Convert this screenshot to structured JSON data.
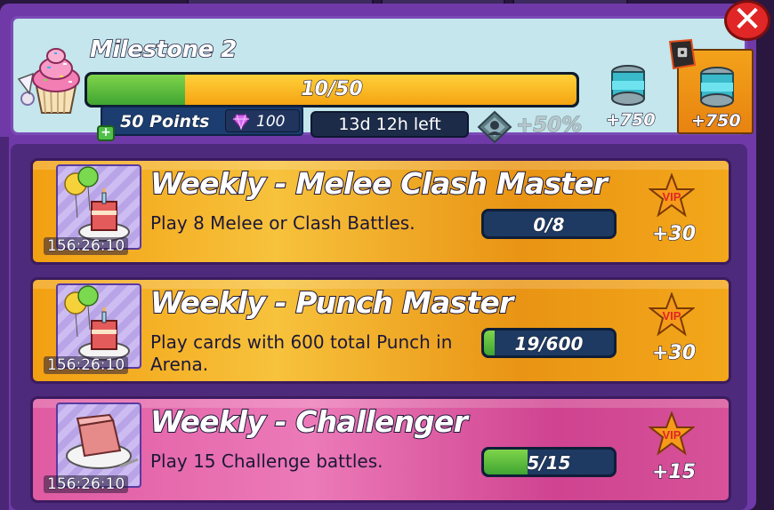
{
  "milestone": {
    "title": "Milestone 2",
    "progress_text": "10/50",
    "progress_fraction": 0.2,
    "points_label": "50 Points",
    "gem_value": "100",
    "time_left": "13d 12h left",
    "bonus": "+50%"
  },
  "rewards": [
    {
      "amount": "+750",
      "icon": "pack-canister-icon"
    },
    {
      "amount": "+750",
      "icon": "pack-canister-icon",
      "locked": true
    }
  ],
  "tasks": [
    {
      "title": "Weekly - Melee Clash Master",
      "description": "Play 8 Melee or Clash Battles.",
      "timer": "156:26:10",
      "progress_text": "0/8",
      "progress_fraction": 0,
      "points": "+30",
      "vip_label": "VIP",
      "style": "gold"
    },
    {
      "title": "Weekly - Punch Master",
      "description": "Play cards with 600 total Punch in Arena.",
      "timer": "156:26:10",
      "progress_text": "19/600",
      "progress_fraction": 0.032,
      "points": "+30",
      "vip_label": "VIP",
      "style": "gold"
    },
    {
      "title": "Weekly - Challenger",
      "description": "Play 15 Challenge battles.",
      "timer": "156:26:10",
      "progress_text": "5/15",
      "progress_fraction": 0.333,
      "points": "+15",
      "vip_label": "VIP",
      "style": "pink"
    }
  ],
  "colors": {
    "frame": "#6f3aa8",
    "gold_card": "#f2a011",
    "pink_card": "#e05ba2",
    "progress_green": "#3fa532",
    "close_red": "#e02626"
  }
}
